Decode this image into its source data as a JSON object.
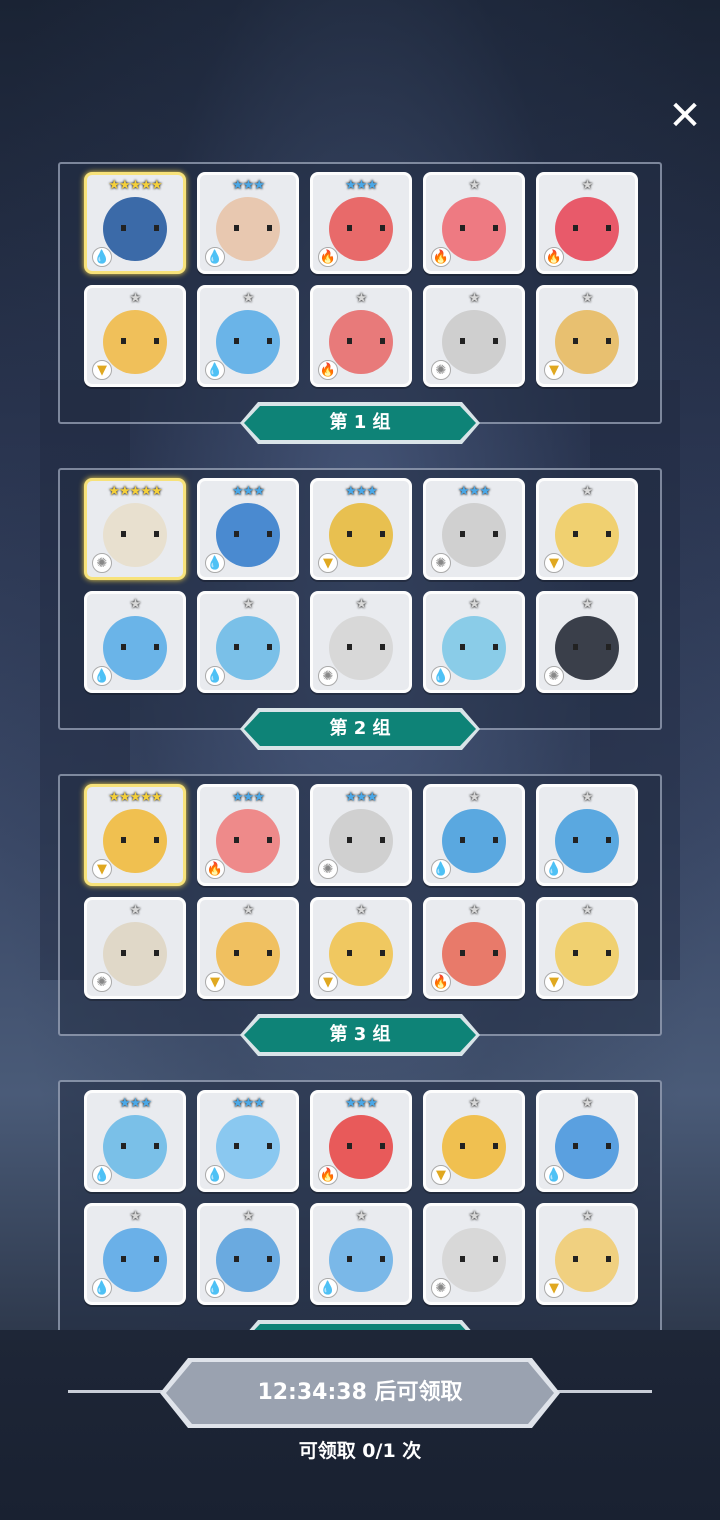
{
  "close_label": "✕",
  "groups": [
    {
      "label": "第 1 组",
      "cards": [
        {
          "stars": "★★★★★",
          "element": "water",
          "color": "#3b6aa8",
          "star_color": "#f5d03a",
          "gold": true
        },
        {
          "stars": "★★★",
          "element": "water",
          "color": "#e8c8b0",
          "star_color": "#4aa8e8",
          "gold": false
        },
        {
          "stars": "★★★",
          "element": "fire",
          "color": "#e86a6a",
          "star_color": "#4aa8e8",
          "gold": false
        },
        {
          "stars": "★",
          "element": "fire",
          "color": "#ee7a82",
          "star_color": "#d8d8d8",
          "gold": false
        },
        {
          "stars": "★",
          "element": "fire",
          "color": "#e85a6a",
          "star_color": "#d8d8d8",
          "gold": false
        },
        {
          "stars": "★",
          "element": "wind",
          "color": "#f0c05a",
          "star_color": "#d8d8d8",
          "gold": false
        },
        {
          "stars": "★",
          "element": "water",
          "color": "#6ab4e8",
          "star_color": "#d8d8d8",
          "gold": false
        },
        {
          "stars": "★",
          "element": "fire",
          "color": "#e87a7a",
          "star_color": "#d8d8d8",
          "gold": false
        },
        {
          "stars": "★",
          "element": "light",
          "color": "#cfcfcf",
          "star_color": "#d8d8d8",
          "gold": false
        },
        {
          "stars": "★",
          "element": "wind",
          "color": "#e8c070",
          "star_color": "#d8d8d8",
          "gold": false
        }
      ]
    },
    {
      "label": "第 2 组",
      "cards": [
        {
          "stars": "★★★★★",
          "element": "light",
          "color": "#e8e0cf",
          "star_color": "#f5d03a",
          "gold": true
        },
        {
          "stars": "★★★",
          "element": "water",
          "color": "#4a8ad0",
          "star_color": "#4aa8e8",
          "gold": false
        },
        {
          "stars": "★★★",
          "element": "wind",
          "color": "#e8c050",
          "star_color": "#4aa8e8",
          "gold": false
        },
        {
          "stars": "★★★",
          "element": "light",
          "color": "#d0d0d0",
          "star_color": "#4aa8e8",
          "gold": false
        },
        {
          "stars": "★",
          "element": "wind",
          "color": "#f0d070",
          "star_color": "#d8d8d8",
          "gold": false
        },
        {
          "stars": "★",
          "element": "water",
          "color": "#6ab4e8",
          "star_color": "#d8d8d8",
          "gold": false
        },
        {
          "stars": "★",
          "element": "water",
          "color": "#7ac0e8",
          "star_color": "#d8d8d8",
          "gold": false
        },
        {
          "stars": "★",
          "element": "light",
          "color": "#d8d8d8",
          "star_color": "#d8d8d8",
          "gold": false
        },
        {
          "stars": "★",
          "element": "water",
          "color": "#8acce8",
          "star_color": "#d8d8d8",
          "gold": false
        },
        {
          "stars": "★",
          "element": "light",
          "color": "#3a3f4a",
          "star_color": "#d8d8d8",
          "gold": false
        }
      ]
    },
    {
      "label": "第 3 组",
      "cards": [
        {
          "stars": "★★★★★",
          "element": "wind",
          "color": "#f0c050",
          "star_color": "#f5d03a",
          "gold": true
        },
        {
          "stars": "★★★",
          "element": "fire",
          "color": "#ee8a8a",
          "star_color": "#4aa8e8",
          "gold": false
        },
        {
          "stars": "★★★",
          "element": "light",
          "color": "#d0d0d0",
          "star_color": "#4aa8e8",
          "gold": false
        },
        {
          "stars": "★",
          "element": "water",
          "color": "#5aa8e0",
          "star_color": "#d8d8d8",
          "gold": false
        },
        {
          "stars": "★",
          "element": "water",
          "color": "#5aa8e0",
          "star_color": "#d8d8d8",
          "gold": false
        },
        {
          "stars": "★",
          "element": "light",
          "color": "#e0d8c8",
          "star_color": "#d8d8d8",
          "gold": false
        },
        {
          "stars": "★",
          "element": "wind",
          "color": "#f0c060",
          "star_color": "#d8d8d8",
          "gold": false
        },
        {
          "stars": "★",
          "element": "wind",
          "color": "#f0c860",
          "star_color": "#d8d8d8",
          "gold": false
        },
        {
          "stars": "★",
          "element": "fire",
          "color": "#e87a6a",
          "star_color": "#d8d8d8",
          "gold": false
        },
        {
          "stars": "★",
          "element": "wind",
          "color": "#f0d070",
          "star_color": "#d8d8d8",
          "gold": false
        }
      ]
    },
    {
      "label": "",
      "cards": [
        {
          "stars": "★★★",
          "element": "water",
          "color": "#7ac0e8",
          "star_color": "#4aa8e8",
          "gold": false
        },
        {
          "stars": "★★★",
          "element": "water",
          "color": "#8ac8f0",
          "star_color": "#4aa8e8",
          "gold": false
        },
        {
          "stars": "★★★",
          "element": "fire",
          "color": "#e85a5a",
          "star_color": "#4aa8e8",
          "gold": false
        },
        {
          "stars": "★",
          "element": "wind",
          "color": "#f0c050",
          "star_color": "#d8d8d8",
          "gold": false
        },
        {
          "stars": "★",
          "element": "water",
          "color": "#5aa0e0",
          "star_color": "#d8d8d8",
          "gold": false
        },
        {
          "stars": "★",
          "element": "water",
          "color": "#6ab0e8",
          "star_color": "#d8d8d8",
          "gold": false
        },
        {
          "stars": "★",
          "element": "water",
          "color": "#6aaae0",
          "star_color": "#d8d8d8",
          "gold": false
        },
        {
          "stars": "★",
          "element": "water",
          "color": "#7ab8e8",
          "star_color": "#d8d8d8",
          "gold": false
        },
        {
          "stars": "★",
          "element": "light",
          "color": "#d8d8d8",
          "star_color": "#d8d8d8",
          "gold": false
        },
        {
          "stars": "★",
          "element": "wind",
          "color": "#f0d080",
          "star_color": "#d8d8d8",
          "gold": false
        }
      ]
    }
  ],
  "element_icons": {
    "water": {
      "glyph": "💧",
      "color": "#2f7fd8",
      "name": "water-element-icon"
    },
    "fire": {
      "glyph": "🔥",
      "color": "#e2463a",
      "name": "fire-element-icon"
    },
    "wind": {
      "glyph": "▼",
      "color": "#e0a820",
      "name": "wind-element-icon"
    },
    "light": {
      "glyph": "✺",
      "color": "#888888",
      "name": "light-element-icon"
    }
  },
  "footer": {
    "timer_text": "12:34:38 后可领取",
    "claim_count_text": "可领取 0/1 次"
  }
}
